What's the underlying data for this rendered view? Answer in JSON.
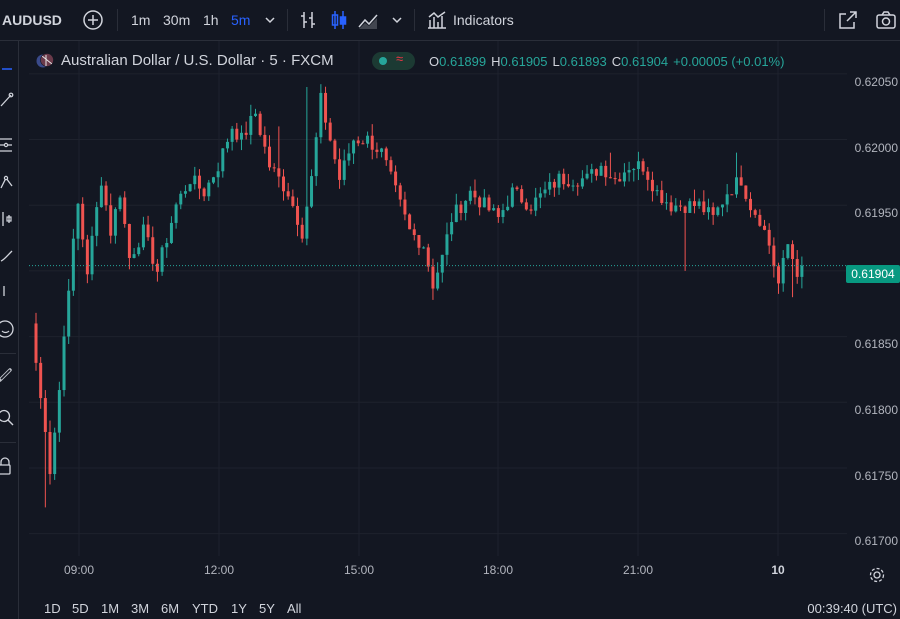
{
  "toolbar": {
    "symbol": "AUDUSD",
    "intervals": [
      "1m",
      "30m",
      "1h",
      "5m"
    ],
    "active_interval": "5m",
    "indicators_label": "Indicators"
  },
  "legend": {
    "title": "Australian Dollar / U.S. Dollar · 5 · FXCM",
    "status_icon": "wave-icon",
    "o_key": "O",
    "o_val": "0.61899",
    "h_key": "H",
    "h_val": "0.61905",
    "l_key": "L",
    "l_val": "0.61893",
    "c_key": "C",
    "c_val": "0.61904",
    "change": "+0.00005 (+0.01%)"
  },
  "price_axis": {
    "labels": [
      "0.62050",
      "0.62000",
      "0.61950",
      "0.61850",
      "0.61800",
      "0.61750",
      "0.61700"
    ],
    "last_price": "0.61904"
  },
  "time_axis": {
    "labels": [
      "09:00",
      "12:00",
      "15:00",
      "18:00",
      "21:00",
      "10"
    ]
  },
  "ranges": [
    "1D",
    "5D",
    "1M",
    "3M",
    "6M",
    "YTD",
    "1Y",
    "5Y",
    "All"
  ],
  "clock": "00:39:40 (UTC)",
  "colors": {
    "up": "#26a69a",
    "down": "#ef5350",
    "background": "#131722",
    "accent": "#2962ff"
  },
  "chart_data": {
    "type": "candlestick",
    "title": "Australian Dollar / U.S. Dollar · 5 · FXCM",
    "interval": "5m",
    "ylim": [
      0.6168,
      0.6207
    ],
    "y_ticks": [
      0.617,
      0.6175,
      0.618,
      0.6185,
      0.6195,
      0.62,
      0.6205
    ],
    "x_ticks": [
      "09:00",
      "12:00",
      "15:00",
      "18:00",
      "21:00",
      "10"
    ],
    "last_close": 0.61904,
    "grid": true,
    "anchor_closes": [
      [
        0,
        0.6183
      ],
      [
        3,
        0.6175
      ],
      [
        5,
        0.6181
      ],
      [
        7,
        0.6189
      ],
      [
        9,
        0.6195
      ],
      [
        11,
        0.619
      ],
      [
        14,
        0.6197
      ],
      [
        16,
        0.6193
      ],
      [
        18,
        0.6196
      ],
      [
        20,
        0.6191
      ],
      [
        23,
        0.6193
      ],
      [
        26,
        0.619
      ],
      [
        30,
        0.6195
      ],
      [
        33,
        0.6197
      ],
      [
        36,
        0.6196
      ],
      [
        39,
        0.6198
      ],
      [
        42,
        0.6201
      ],
      [
        44,
        0.62
      ],
      [
        47,
        0.6202
      ],
      [
        50,
        0.6198
      ],
      [
        54,
        0.6196
      ],
      [
        57,
        0.6193
      ],
      [
        59,
        0.6197
      ],
      [
        61,
        0.6203
      ],
      [
        63,
        0.62
      ],
      [
        65,
        0.6197
      ],
      [
        68,
        0.62
      ],
      [
        71,
        0.62
      ],
      [
        74,
        0.6199
      ],
      [
        77,
        0.6196
      ],
      [
        80,
        0.6193
      ],
      [
        83,
        0.6192
      ],
      [
        85,
        0.6189
      ],
      [
        87,
        0.6191
      ],
      [
        89,
        0.6194
      ],
      [
        93,
        0.6196
      ],
      [
        96,
        0.6195
      ],
      [
        99,
        0.6194
      ],
      [
        102,
        0.6196
      ],
      [
        106,
        0.6195
      ],
      [
        109,
        0.6196
      ],
      [
        112,
        0.6197
      ],
      [
        115,
        0.6197
      ],
      [
        118,
        0.6197
      ],
      [
        121,
        0.6198
      ],
      [
        124,
        0.6197
      ],
      [
        127,
        0.6198
      ],
      [
        130,
        0.6198
      ],
      [
        133,
        0.6196
      ],
      [
        136,
        0.6195
      ],
      [
        139,
        0.6195
      ],
      [
        142,
        0.6195
      ],
      [
        145,
        0.6194
      ],
      [
        148,
        0.6196
      ],
      [
        151,
        0.6197
      ],
      [
        153,
        0.6195
      ],
      [
        155,
        0.6194
      ],
      [
        157,
        0.6192
      ],
      [
        159,
        0.6189
      ],
      [
        161,
        0.6192
      ],
      [
        163,
        0.619
      ],
      [
        164,
        0.61904
      ]
    ],
    "spikes": [
      [
        2,
        0.6172,
        "low"
      ],
      [
        52,
        0.6201,
        "high"
      ],
      [
        58,
        0.6204,
        "high"
      ],
      [
        123,
        0.6199,
        "high"
      ],
      [
        139,
        0.619,
        "low"
      ],
      [
        150,
        0.6199,
        "high"
      ],
      [
        162,
        0.6188,
        "low"
      ]
    ]
  }
}
